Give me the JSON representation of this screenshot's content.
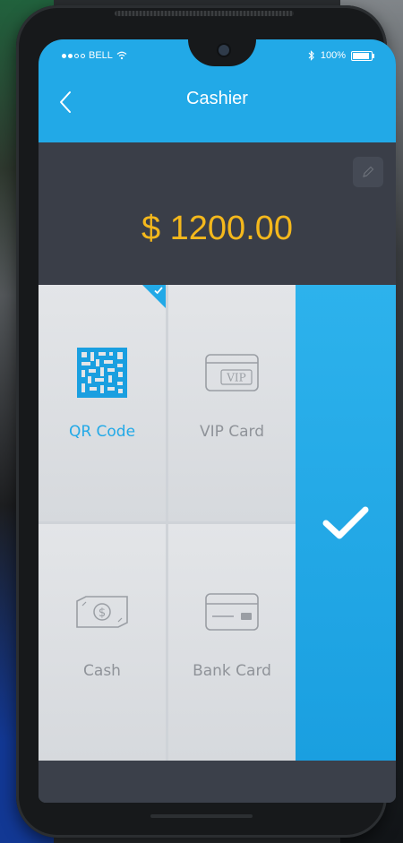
{
  "status_bar": {
    "carrier": "BELL",
    "battery_text": "100%",
    "battery_level": 1.0
  },
  "header": {
    "title": "Cashier"
  },
  "payment": {
    "amount": "$ 1200.00"
  },
  "methods": [
    {
      "label": "QR Code",
      "icon": "qr-code-icon",
      "selected": true
    },
    {
      "label": "VIP Card",
      "icon": "vip-card-icon",
      "selected": false
    },
    {
      "label": "Cash",
      "icon": "cash-icon",
      "selected": false
    },
    {
      "label": "Bank Card",
      "icon": "bank-card-icon",
      "selected": false
    }
  ],
  "colors": {
    "accent": "#22a9e7",
    "amount": "#f4b81c",
    "panel": "#3a3e48"
  }
}
